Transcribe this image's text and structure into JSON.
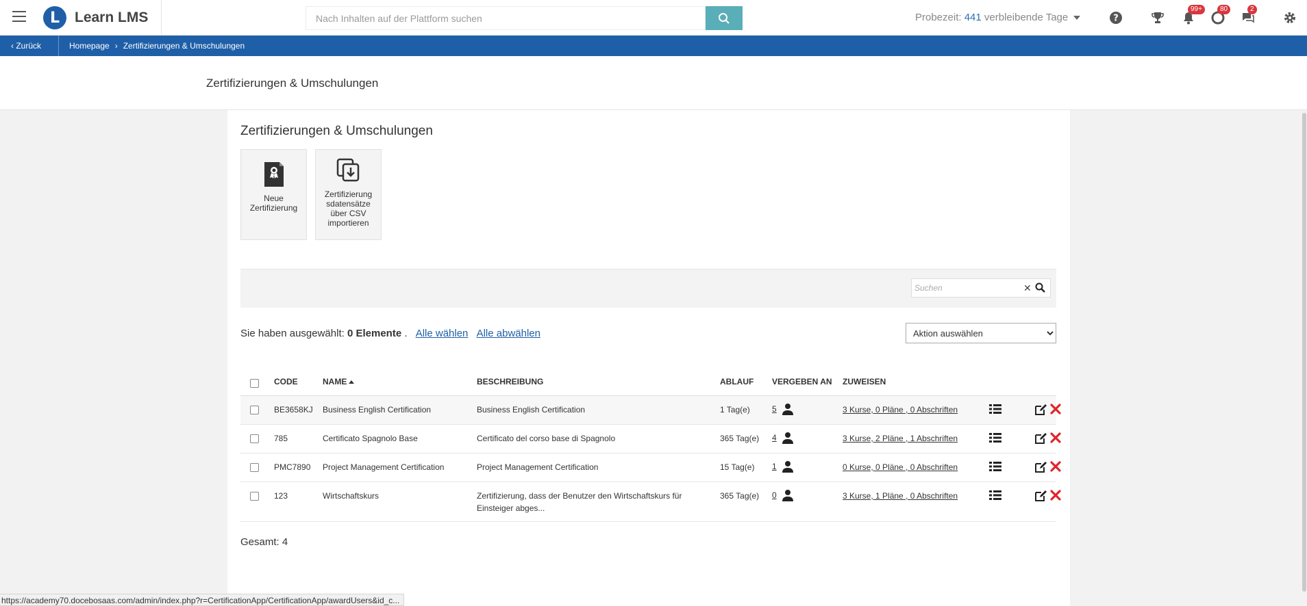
{
  "app": {
    "name": "Learn LMS",
    "logo_letter": "L"
  },
  "header": {
    "search_placeholder": "Nach Inhalten auf der Plattform suchen",
    "trial_prefix": "Probezeit:",
    "trial_days": "441",
    "trial_suffix": "verbleibende Tage",
    "badges": {
      "notifications": "99+",
      "messages": "80",
      "chat": "2"
    }
  },
  "breadcrumb": {
    "back": "Zurück",
    "home": "Homepage",
    "current": "Zertifizierungen & Umschulungen"
  },
  "page_title": "Zertifizierungen & Umschulungen",
  "panel_title": "Zertifizierungen & Umschulungen",
  "tiles": {
    "new_cert": "Neue Zertifizierung",
    "import_csv": "Zertifizierung sdatensätze über CSV importieren"
  },
  "filter": {
    "search_placeholder": "Suchen"
  },
  "selection": {
    "prefix": "Sie haben ausgewählt:",
    "count": "0 Elemente",
    "dot": ".",
    "select_all": "Alle wählen",
    "deselect_all": "Alle abwählen"
  },
  "action_select": {
    "selected": "Aktion auswählen"
  },
  "table": {
    "headers": {
      "code": "CODE",
      "name": "NAME",
      "description": "BESCHREIBUNG",
      "expiry": "ABLAUF",
      "awarded": "VERGEBEN AN",
      "assign": "ZUWEISEN"
    },
    "rows": [
      {
        "code": "BE3658KJ",
        "name": "Business English Certification",
        "description": "Business English Certification",
        "expiry": "1 Tag(e)",
        "awarded": "5",
        "assign": "3 Kurse, 0 Pläne , 0 Abschriften"
      },
      {
        "code": "785",
        "name": "Certificato Spagnolo Base",
        "description": "Certificato del corso base di Spagnolo",
        "expiry": "365 Tag(e)",
        "awarded": "4",
        "assign": "3 Kurse, 2 Pläne , 1 Abschriften"
      },
      {
        "code": "PMC7890",
        "name": "Project Management Certification",
        "description": "Project Management Certification",
        "expiry": "15 Tag(e)",
        "awarded": "1",
        "assign": "0 Kurse, 0 Pläne , 0 Abschriften"
      },
      {
        "code": "123",
        "name": "Wirtschaftskurs",
        "description": "Zertifizierung, dass der Benutzer den Wirtschaftskurs für Einsteiger abges...",
        "expiry": "365 Tag(e)",
        "awarded": "0",
        "assign": "3 Kurse, 1 Pläne , 0 Abschriften"
      }
    ]
  },
  "total": "Gesamt: 4",
  "status_url": "https://academy70.docebosaas.com/admin/index.php?r=CertificationApp/CertificationApp/awardUsers&id_c...",
  "colors": {
    "brand_blue": "#1f5fa8",
    "search_teal": "#5aaeb8",
    "badge_red": "#d9363e",
    "delete_red": "#e0242b"
  }
}
